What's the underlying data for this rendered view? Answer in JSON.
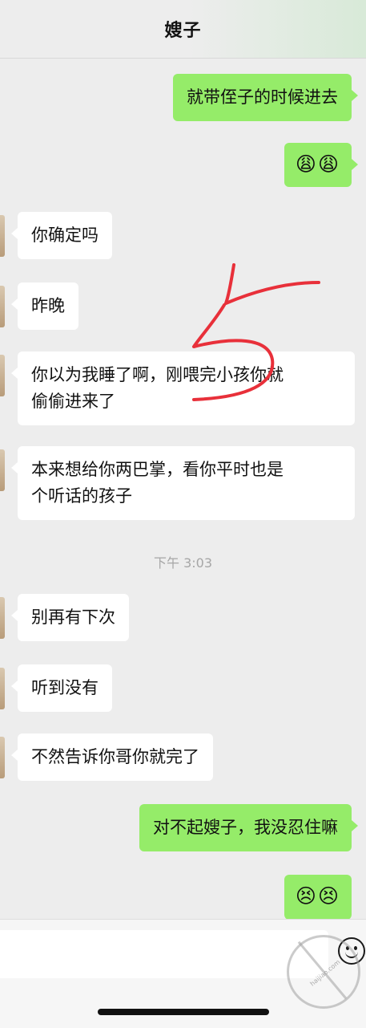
{
  "header": {
    "title": "嫂子"
  },
  "messages": [
    {
      "side": "out",
      "text": "就带侄子的时候进去"
    },
    {
      "side": "out",
      "emoji": [
        "😩",
        "😩"
      ]
    },
    {
      "side": "in",
      "text": "你确定吗"
    },
    {
      "side": "in",
      "text": "昨晚"
    },
    {
      "side": "in",
      "line1": "你以为我睡了啊，刚喂完小孩你就",
      "line2": "偷偷进来了"
    },
    {
      "side": "in",
      "line1": "本来想给你两巴掌，看你平时也是",
      "line2": "个听话的孩子"
    },
    {
      "side": "in",
      "text": "别再有下次"
    },
    {
      "side": "in",
      "text": "听到没有"
    },
    {
      "side": "in",
      "text": "不然告诉你哥你就完了"
    },
    {
      "side": "out",
      "text": "对不起嫂子，我没忍住嘛"
    },
    {
      "side": "out",
      "emoji": [
        "😣",
        "😣"
      ]
    }
  ],
  "timestamp": "下午 3:03",
  "input": {
    "value": "",
    "placeholder": ""
  },
  "icons": {
    "emoji_button": "smiley-icon"
  },
  "colors": {
    "outgoing_bubble": "#95ec69",
    "incoming_bubble": "#ffffff",
    "annotation": "#e8303a"
  }
}
